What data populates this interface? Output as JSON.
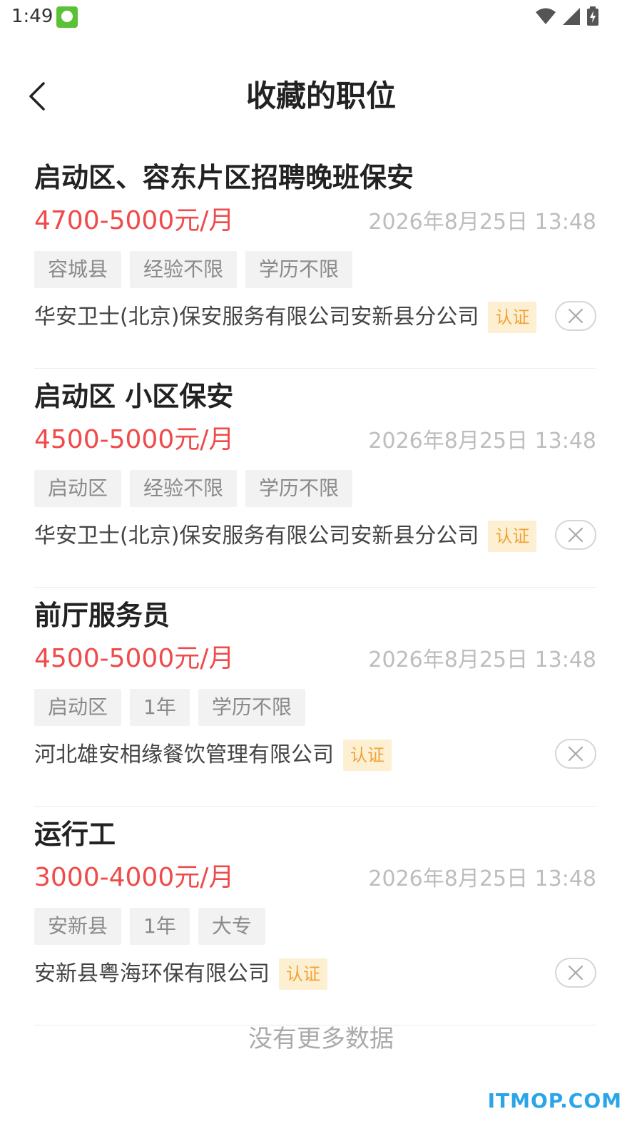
{
  "status_bar": {
    "time": "1:49",
    "icons": [
      "app-badge-icon",
      "wifi-icon",
      "cellular-signal-icon",
      "battery-charging-icon"
    ]
  },
  "header": {
    "back_icon": "chevron-left-icon",
    "title": "收藏的职位"
  },
  "jobs": [
    {
      "title": "启动区、容东片区招聘晚班保安",
      "salary": "4700-5000元/月",
      "date": "2026年8月25日 13:48",
      "tags": [
        "容城县",
        "经验不限",
        "学历不限"
      ],
      "company": "华安卫士(北京)保安服务有限公司安新县分公司",
      "verified": "认证"
    },
    {
      "title": "启动区 小区保安",
      "salary": "4500-5000元/月",
      "date": "2026年8月25日 13:48",
      "tags": [
        "启动区",
        "经验不限",
        "学历不限"
      ],
      "company": "华安卫士(北京)保安服务有限公司安新县分公司",
      "verified": "认证"
    },
    {
      "title": "前厅服务员",
      "salary": "4500-5000元/月",
      "date": "2026年8月25日 13:48",
      "tags": [
        "启动区",
        "1年",
        "学历不限"
      ],
      "company": "河北雄安相缘餐饮管理有限公司",
      "verified": "认证"
    },
    {
      "title": "运行工",
      "salary": "3000-4000元/月",
      "date": "2026年8月25日 13:48",
      "tags": [
        "安新县",
        "1年",
        "大专"
      ],
      "company": "安新县粤海环保有限公司",
      "verified": "认证"
    }
  ],
  "footer": {
    "no_more": "没有更多数据"
  },
  "watermark": "ITMOP.COM",
  "colors": {
    "salary": "#f04a4a",
    "verified_bg": "#fdf0d2",
    "verified_text": "#f0a23a",
    "watermark": "#2aa5e8"
  }
}
